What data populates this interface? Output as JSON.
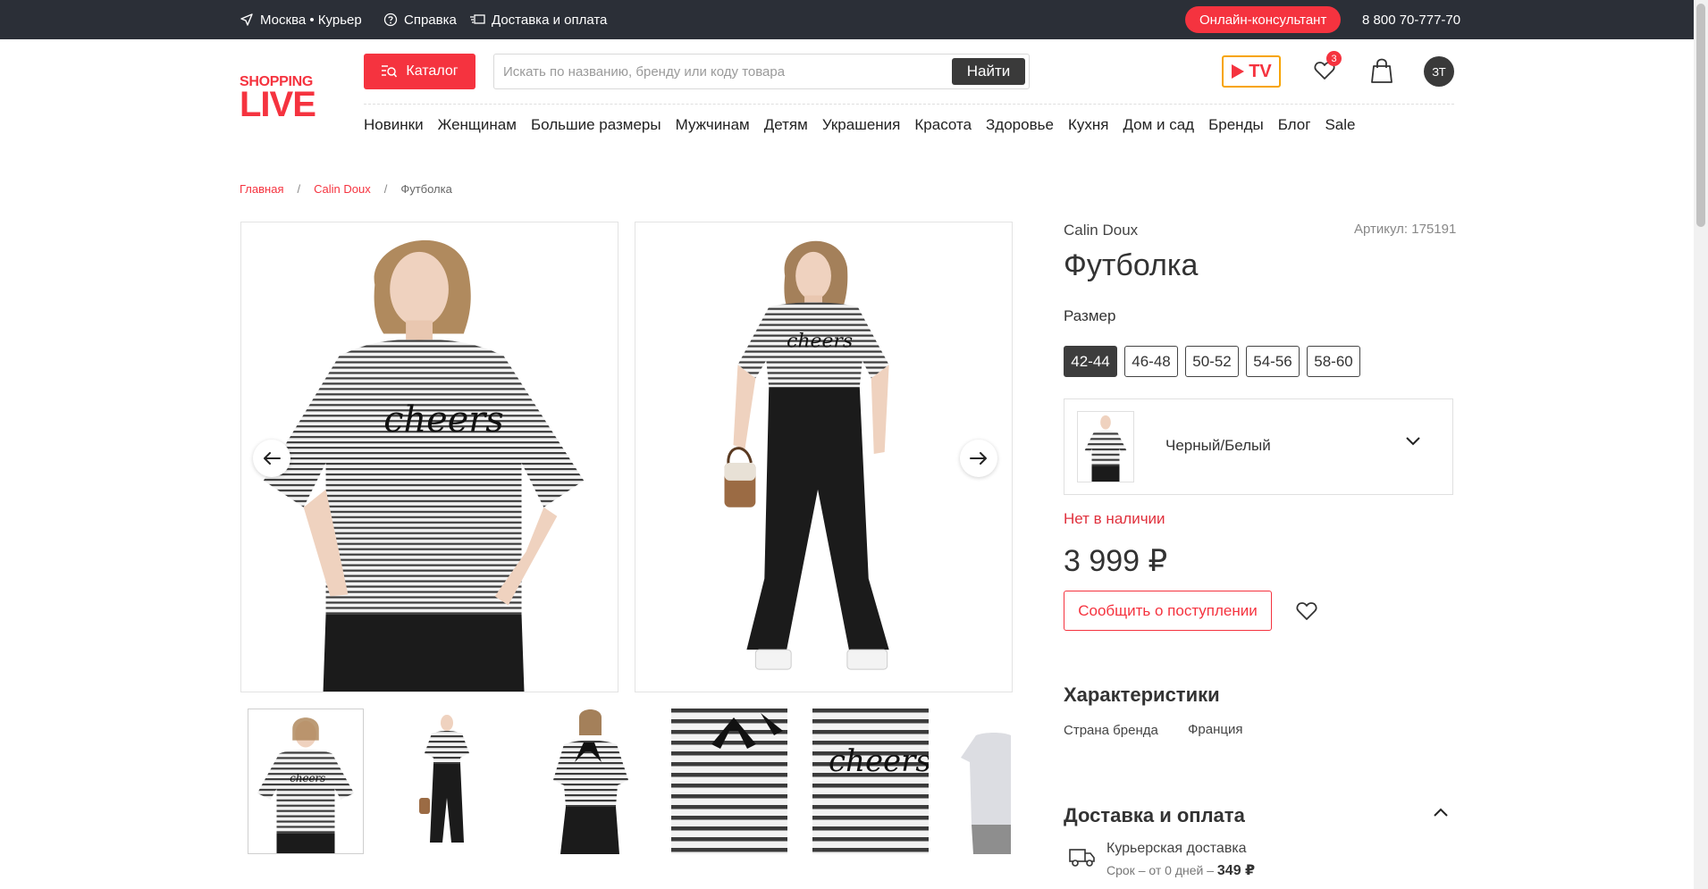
{
  "topbar": {
    "location": "Москва • Курьер",
    "help": "Справка",
    "delivery": "Доставка и оплата",
    "consultant": "Онлайн-консультант",
    "phone": "8 800 70-777-70"
  },
  "header": {
    "logo_line1": "SHOPPING",
    "logo_line2": "LIVE",
    "catalog": "Каталог",
    "search_placeholder": "Искать по названию, бренду или коду товара",
    "search_button": "Найти",
    "tv_label": "TV",
    "favorites_count": "3",
    "avatar_initials": "ЗТ"
  },
  "nav": [
    "Новинки",
    "Женщинам",
    "Большие размеры",
    "Мужчинам",
    "Детям",
    "Украшения",
    "Красота",
    "Здоровье",
    "Кухня",
    "Дом и сад",
    "Бренды",
    "Блог",
    "Sale"
  ],
  "breadcrumb": {
    "home": "Главная",
    "brand": "Calin Doux",
    "current": "Футболка",
    "separator": "/"
  },
  "product": {
    "brand": "Calin Doux",
    "article": "Артикул: 175191",
    "title": "Футболка",
    "size_label": "Размер",
    "sizes": [
      "42-44",
      "46-48",
      "50-52",
      "54-56",
      "58-60"
    ],
    "selected_size": "42-44",
    "color": "Черный/Белый",
    "stock": "Нет в наличии",
    "price": "3 999 ₽",
    "notify": "Сообщить о поступлении"
  },
  "characteristics": {
    "title": "Характеристики",
    "rows": [
      {
        "key": "Страна бренда",
        "value": "Франция"
      }
    ]
  },
  "delivery": {
    "title": "Доставка и оплата",
    "method": "Курьерская доставка",
    "term": "Срок – от 0 дней –",
    "cost": "349 ₽"
  },
  "colors": {
    "accent": "#f5333f",
    "topbar": "#2b2f37",
    "dark": "#3d3d3d",
    "tv_border": "#f7a400"
  }
}
